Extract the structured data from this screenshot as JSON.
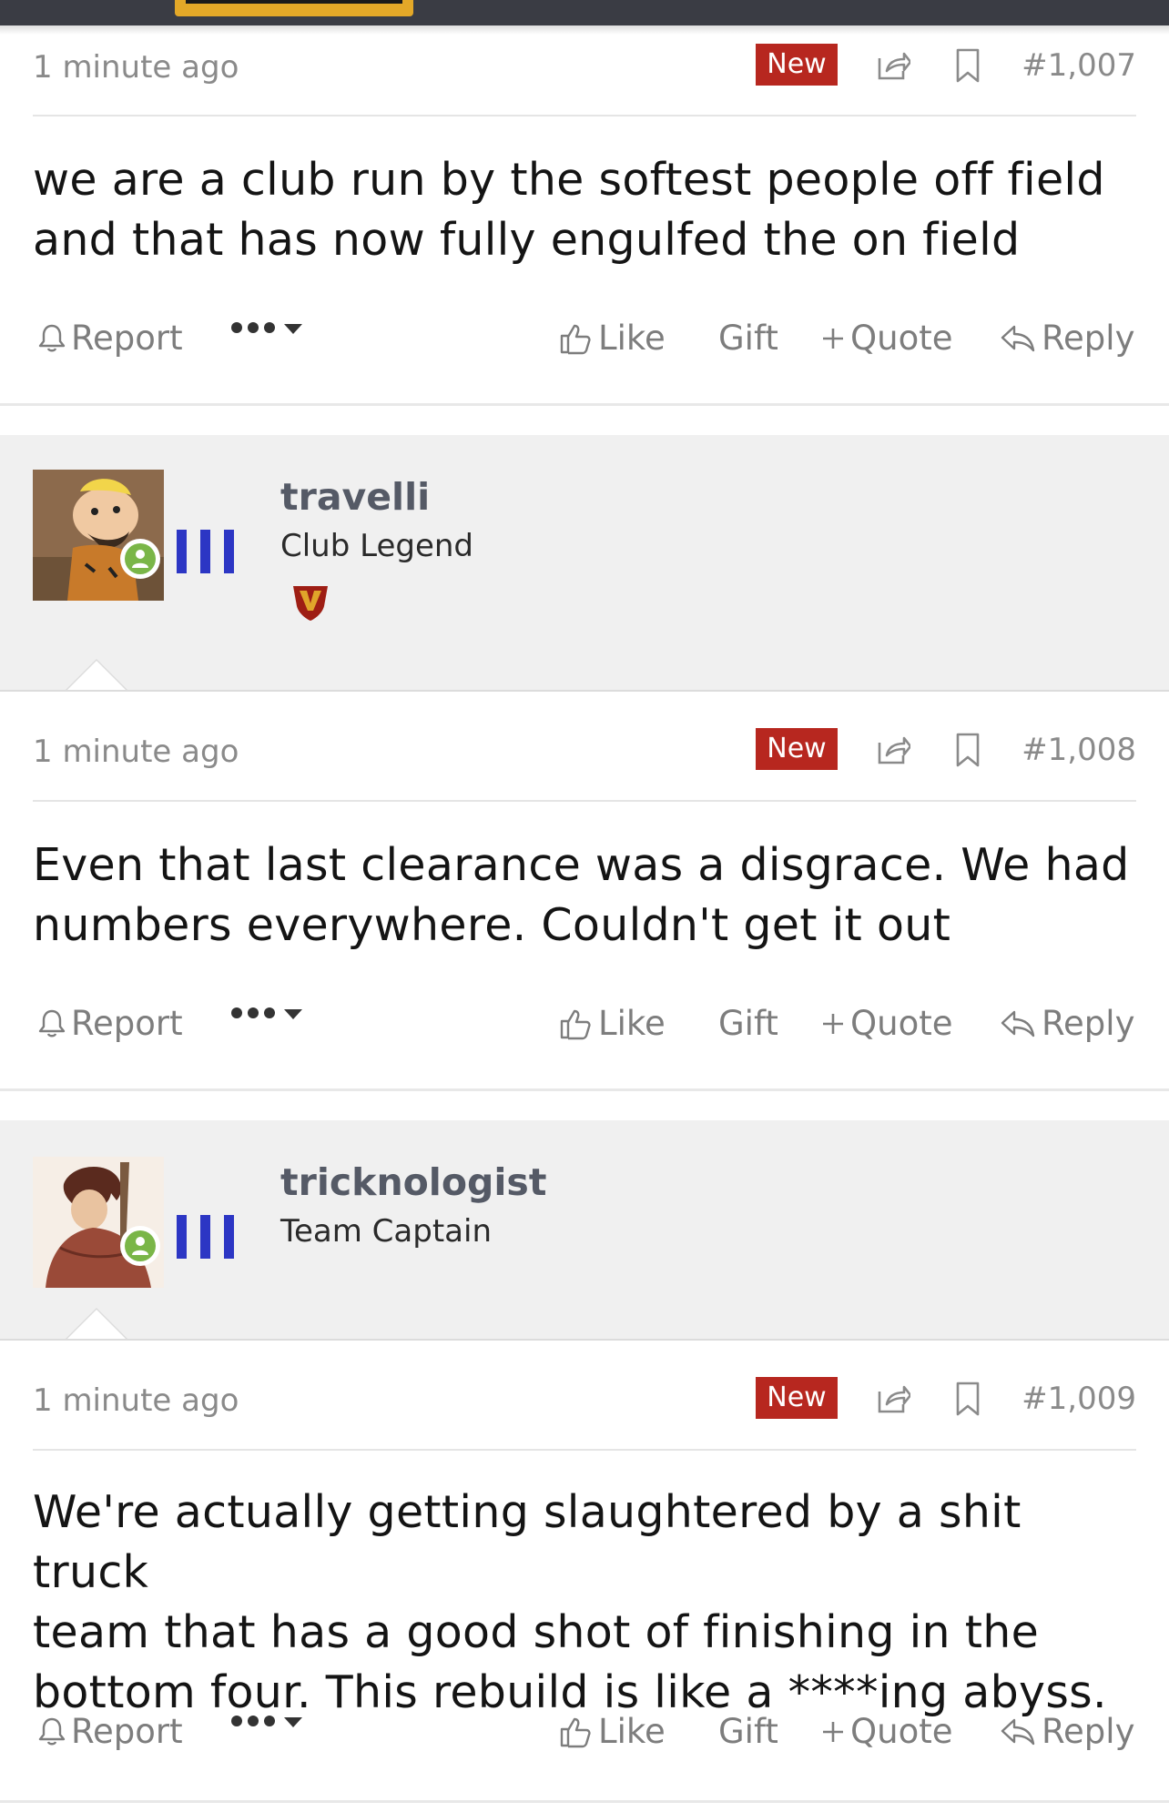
{
  "posts": [
    {
      "time": "1 minute ago",
      "badge": "New",
      "number": "#1,007",
      "lines": [
        "we are a club run by the softest people off field",
        "and that has now fully engulfed the on field"
      ],
      "actions": {
        "report": "Report",
        "like": "Like",
        "gift": "Gift",
        "quote": "Quote",
        "reply": "Reply"
      }
    },
    {
      "user": {
        "name": "travelli",
        "title": "Club Legend",
        "has_vbadge": true,
        "online": true
      },
      "time": "1 minute ago",
      "badge": "New",
      "number": "#1,008",
      "lines": [
        "Even that last clearance was a disgrace. We had",
        "numbers everywhere. Couldn't get it out"
      ],
      "actions": {
        "report": "Report",
        "like": "Like",
        "gift": "Gift",
        "quote": "Quote",
        "reply": "Reply"
      }
    },
    {
      "user": {
        "name": "tricknologist",
        "title": "Team Captain",
        "online": true
      },
      "time": "1 minute ago",
      "badge": "New",
      "number": "#1,009",
      "lines": [
        "We're actually getting slaughtered by a shit truck",
        "team that has a good shot of finishing in the",
        "bottom four. This rebuild is like a ****ing abyss."
      ],
      "actions": {
        "report": "Report",
        "like": "Like",
        "gift": "Gift",
        "quote": "Quote",
        "reply": "Reply"
      }
    }
  ],
  "colors": {
    "new_badge": "#b7271f",
    "online": "#7ab648",
    "stripes": "#2c36c4"
  },
  "icons": [
    "share-icon",
    "bookmark-icon",
    "bell-icon",
    "more-icon",
    "thumbs-up-icon",
    "plus-icon",
    "reply-icon",
    "user-icon"
  ]
}
